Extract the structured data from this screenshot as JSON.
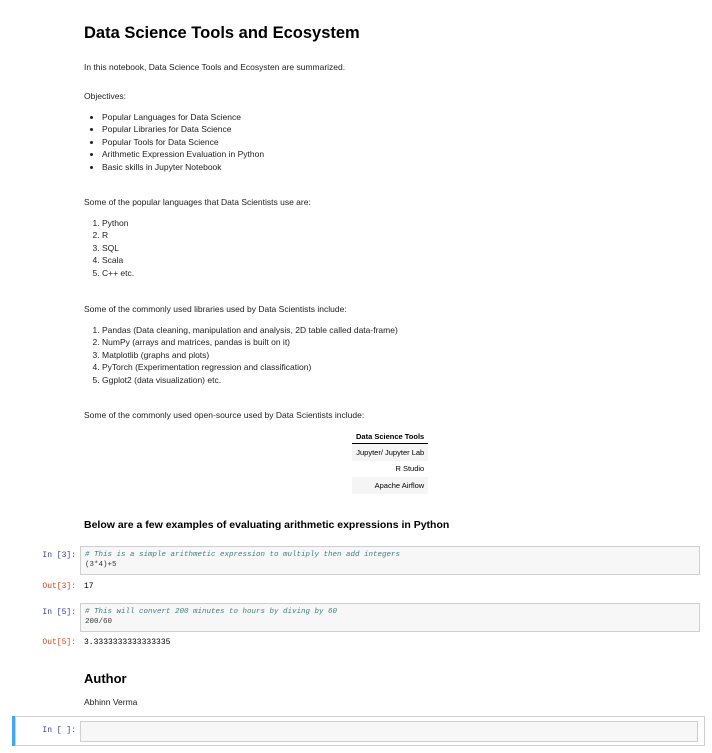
{
  "title": "Data Science Tools and Ecosystem",
  "intro": "In this notebook, Data Science Tools and Ecosysten are summarized.",
  "objectives_label": "Objectives:",
  "objectives": [
    "Popular Languages for Data Science",
    "Popular Libraries for Data Science",
    "Popular Tools for Data Science",
    "Arithmetic Expression Evaluation in Python",
    "Basic skills in Jupyter Notebook"
  ],
  "languages_label": "Some of the popular languages that Data Scientists use are:",
  "languages": [
    "Python",
    "R",
    "SQL",
    "Scala",
    "C++ etc."
  ],
  "libraries_label": "Some of the commonly used libraries used by Data Scientists include:",
  "libraries": [
    "Pandas (Data cleaning, manipulation and analysis, 2D table called data-frame)",
    "NumPy (arrays and matrices, pandas is built on it)",
    "Matplotlib (graphs and plots)",
    "PyTorch (Experimentation regression and classification)",
    "Ggplot2 (data visualization) etc."
  ],
  "tools_label": "Some of the commonly used open-source used by Data Scientists include:",
  "tools_table": {
    "header": "Data Science Tools",
    "rows": [
      "Jupyter/ Jupyter Lab",
      "R Studio",
      "Apache Airflow"
    ]
  },
  "examples_heading": "Below are a few examples of evaluating arithmetic expressions in Python",
  "cell1": {
    "in_prompt": "In [3]:",
    "comment": "# This is a simple arithmetic expression to multiply then add integers",
    "code": "(3*4)+5",
    "out_prompt": "Out[3]:",
    "output": "17"
  },
  "cell2": {
    "in_prompt": "In [5]:",
    "comment": "# This will convert 200 minutes to hours by diving by 60",
    "code": "200/60",
    "out_prompt": "Out[5]:",
    "output": "3.3333333333333335"
  },
  "author_heading": "Author",
  "author_name": "Abhinn Verma",
  "empty_cell": {
    "in_prompt": "In [ ]:"
  },
  "colors": {
    "prompt_in": "#303f9f",
    "prompt_out": "#d84315",
    "selected": "#42a5f5"
  }
}
